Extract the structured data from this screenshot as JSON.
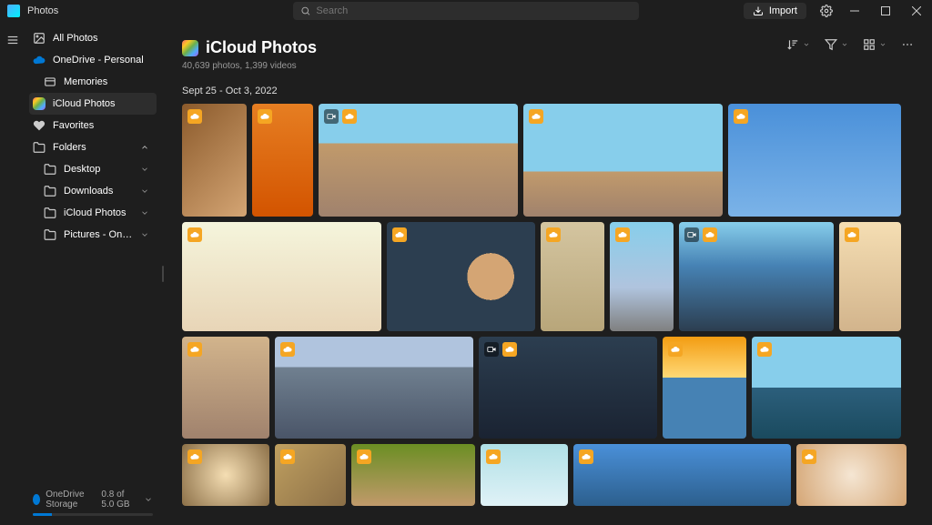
{
  "app": {
    "title": "Photos"
  },
  "search": {
    "placeholder": "Search"
  },
  "import": {
    "label": "Import"
  },
  "sidebar": {
    "all_photos": "All Photos",
    "onedrive": "OneDrive - Personal",
    "memories": "Memories",
    "icloud": "iCloud Photos",
    "favorites": "Favorites",
    "folders": "Folders",
    "folder_items": [
      "Desktop",
      "Downloads",
      "iCloud Photos",
      "Pictures - OneDrive Personal"
    ]
  },
  "storage": {
    "label": "OneDrive Storage",
    "text": "0.8 of 5.0 GB",
    "percent": 16
  },
  "page": {
    "title": "iCloud Photos",
    "subtitle": "40,639 photos, 1,399 videos"
  },
  "sections": [
    {
      "date": "Sept 25 - Oct 3, 2022"
    }
  ]
}
